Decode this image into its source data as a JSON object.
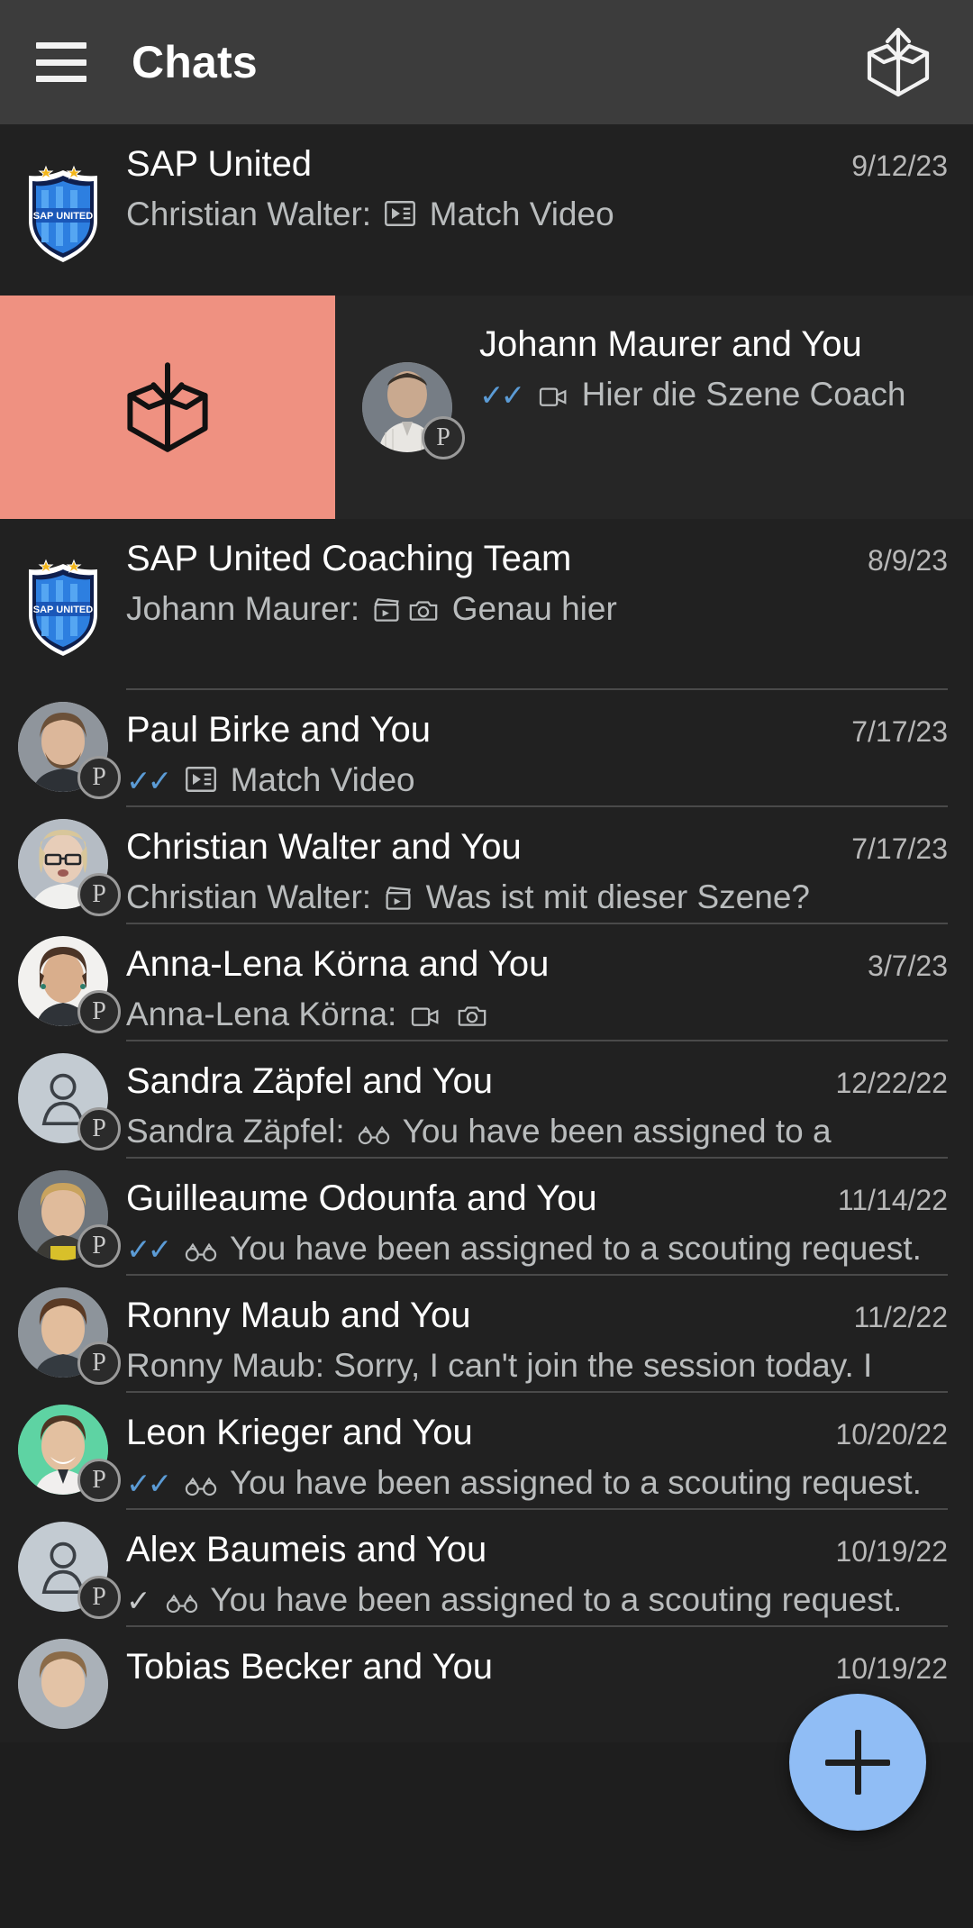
{
  "header": {
    "title": "Chats",
    "menu_icon": "hamburger-menu-icon",
    "action_icon": "unarchive-box-icon"
  },
  "swipe": {
    "action_icon": "archive-box-icon",
    "action_color": "#ef9181"
  },
  "fab": {
    "icon": "plus-icon",
    "color": "#90bdf5"
  },
  "colors": {
    "background": "#1e1e1e",
    "row_background": "#212121",
    "appbar": "#3c3c3c",
    "title_text": "#ffffff",
    "preview_text": "#b9bcbd",
    "date_text": "#b8b8b8",
    "read_ticks": "#5b9bd5",
    "divider": "#4a4a4a"
  },
  "chats": [
    {
      "title": "SAP United",
      "date": "9/12/23",
      "sender": "Christian Walter: ",
      "ticks": "",
      "icons": [
        "match-video-icon"
      ],
      "preview": "Match Video",
      "avatar": "sap-united-crest",
      "badge": ""
    },
    {
      "title": "Johann Maurer and You",
      "date": "",
      "sender": "",
      "ticks": "read-double-check",
      "icons": [
        "video-camera-icon"
      ],
      "preview": "Hier die Szene Coach",
      "avatar": "photo-johann-maurer",
      "badge": "P",
      "swiped": true
    },
    {
      "title": "SAP United Coaching Team",
      "date": "8/9/23",
      "sender": "Johann Maurer: ",
      "ticks": "",
      "icons": [
        "clapperboard-icon",
        "camera-icon"
      ],
      "preview": "Genau hier",
      "avatar": "sap-united-crest",
      "badge": ""
    },
    {
      "title": "Paul Birke and You",
      "date": "7/17/23",
      "sender": "",
      "ticks": "read-double-check",
      "icons": [
        "match-video-icon"
      ],
      "preview": "Match Video",
      "avatar": "photo-paul-birke",
      "badge": "P"
    },
    {
      "title": "Christian Walter and You",
      "date": "7/17/23",
      "sender": "Christian Walter: ",
      "ticks": "",
      "icons": [
        "clapperboard-icon"
      ],
      "preview": "Was ist mit dieser Szene?",
      "avatar": "photo-christian-walter",
      "badge": "P"
    },
    {
      "title": "Anna-Lena Körna and You",
      "date": "3/7/23",
      "sender": "Anna-Lena Körna: ",
      "ticks": "",
      "icons": [
        "video-camera-icon",
        "camera-icon"
      ],
      "preview": "",
      "avatar": "photo-anna-lena-koerna",
      "badge": "P"
    },
    {
      "title": "Sandra Zäpfel and You",
      "date": "12/22/22",
      "sender": "Sandra Zäpfel: ",
      "ticks": "",
      "icons": [
        "binoculars-icon"
      ],
      "preview": "You have been assigned to a scouting request.",
      "avatar": "placeholder-person",
      "badge": "P"
    },
    {
      "title": "Guilleaume Odounfa and You",
      "date": "11/14/22",
      "sender": "",
      "ticks": "read-double-check",
      "icons": [
        "binoculars-icon"
      ],
      "preview": "You have been assigned to a scouting request.",
      "avatar": "photo-guilleaume-odounfa",
      "badge": "P"
    },
    {
      "title": "Ronny Maub and You",
      "date": "11/2/22",
      "sender": "Ronny Maub: ",
      "ticks": "",
      "icons": [],
      "preview": "Sorry, I can't join the session today. I have another appointment",
      "avatar": "photo-ronny-maub",
      "badge": "P"
    },
    {
      "title": "Leon Krieger and You",
      "date": "10/20/22",
      "sender": "",
      "ticks": "read-double-check",
      "icons": [
        "binoculars-icon"
      ],
      "preview": "You have been assigned to a scouting request.",
      "avatar": "photo-leon-krieger",
      "badge": "P"
    },
    {
      "title": "Alex Baumeis and You",
      "date": "10/19/22",
      "sender": "",
      "ticks": "sent-single-check",
      "icons": [
        "binoculars-icon"
      ],
      "preview": "You have been assigned to a scouting request.",
      "avatar": "placeholder-person",
      "badge": "P"
    },
    {
      "title": "Tobias Becker and You",
      "date": "10/19/22",
      "sender": "",
      "ticks": "",
      "icons": [],
      "preview": "",
      "avatar": "photo-tobias-becker",
      "badge": ""
    }
  ]
}
